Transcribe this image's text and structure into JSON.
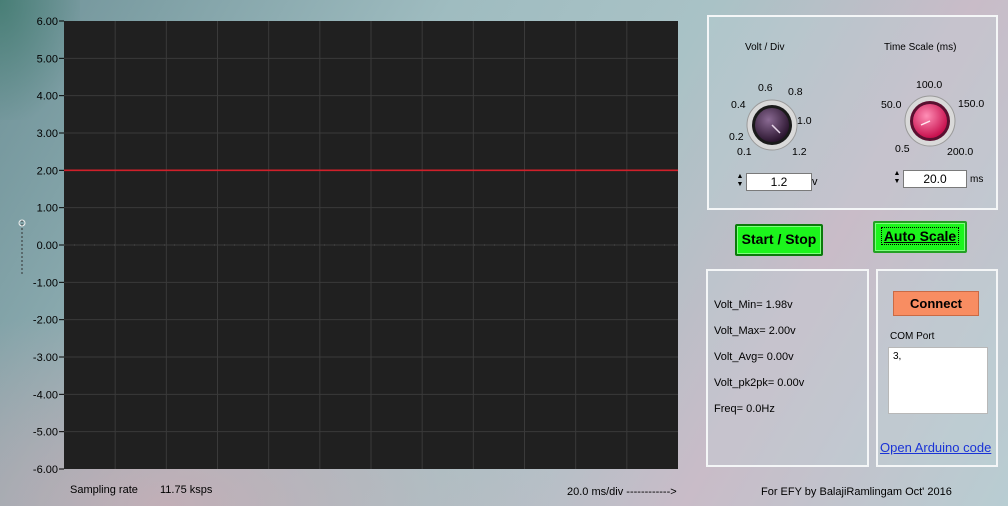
{
  "scope": {
    "y_ticks": [
      "6.00",
      "5.00",
      "4.00",
      "3.00",
      "2.00",
      "1.00",
      "0.00",
      "-1.00",
      "-2.00",
      "-3.00",
      "-4.00",
      "-5.00",
      "-6.00"
    ],
    "ylim": [
      -6,
      6
    ],
    "trace_value": 2.0,
    "trace_color": "#d0202a",
    "plot_bg": "#202020",
    "grid_color": "#3a3a3a"
  },
  "volt_div": {
    "title": "Volt / Div",
    "scale_labels": [
      "0.1",
      "0.2",
      "0.4",
      "0.6",
      "0.8",
      "1.0",
      "1.2"
    ],
    "knob_value": 1.2,
    "knob_color": "#5b3a63",
    "spinner_value": "1.2",
    "unit": "v"
  },
  "time_scale": {
    "title": "Time Scale (ms)",
    "scale_labels": [
      "0.5",
      "50.0",
      "100.0",
      "150.0",
      "200.0"
    ],
    "knob_value": 20.0,
    "knob_color": "#f0206a",
    "spinner_value": "20.0",
    "unit": "ms"
  },
  "buttons": {
    "start_stop": "Start / Stop",
    "auto_scale": "Auto Scale",
    "connect": "Connect"
  },
  "stats": {
    "volt_min": "Volt_Min= 1.98v",
    "volt_max": "Volt_Max= 2.00v",
    "volt_avg": "Volt_Avg= 0.00v",
    "volt_pk2pk": "Volt_pk2pk= 0.00v",
    "freq": "Freq= 0.0Hz"
  },
  "com": {
    "label": "COM Port",
    "value": "3,"
  },
  "link_text": "Open Arduino code",
  "footer": {
    "sampling_label": "Sampling rate",
    "sampling_value": "11.75  ksps",
    "time_div": "20.0  ms/div  ------------>",
    "credit": "For EFY by BalajiRamlingam Oct' 2016"
  }
}
